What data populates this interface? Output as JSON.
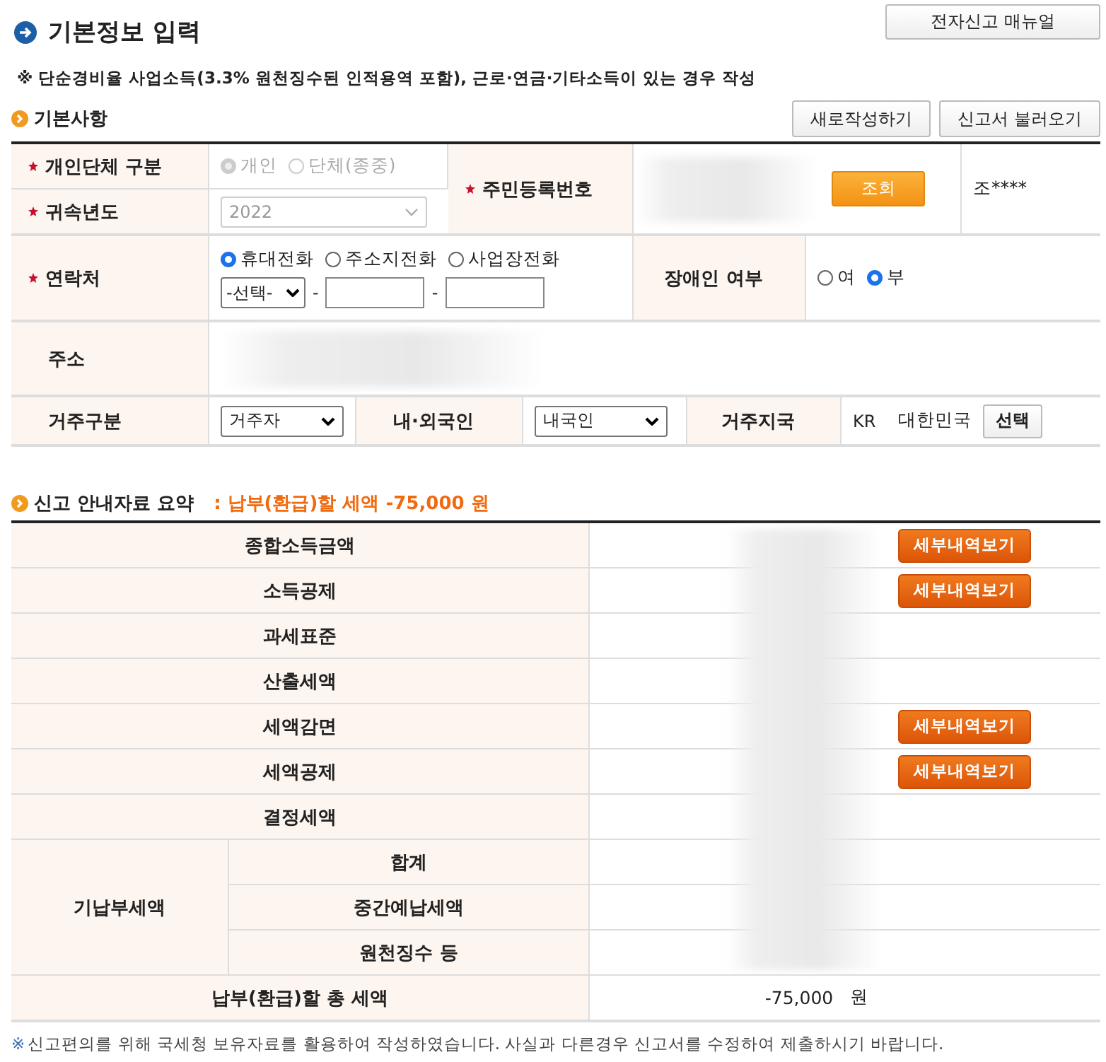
{
  "page_title": "기본정보 입력",
  "manual_button": "전자신고 매뉴얼",
  "notice": "※ 단순경비율 사업소득(3.3% 원천징수된 인적용역 포함), 근로·연금·기타소득이 있는 경우 작성",
  "basic": {
    "title": "기본사항",
    "buttons": [
      "새로작성하기",
      "신고서 불러오기"
    ],
    "entity_type": {
      "label": "개인단체 구분",
      "required": true,
      "disabled": true,
      "options": [
        {
          "label": "개인",
          "selected": true
        },
        {
          "label": "단체(종중)",
          "selected": false
        }
      ]
    },
    "year": {
      "label": "귀속년도",
      "required": true,
      "value": "2022",
      "disabled": true
    },
    "resident_id": {
      "label": "주민등록번호",
      "required": true,
      "button": "조회",
      "name": "조****"
    },
    "contact": {
      "label": "연락처",
      "required": true,
      "options": [
        {
          "label": "휴대전화",
          "selected": true
        },
        {
          "label": "주소지전화",
          "selected": false
        },
        {
          "label": "사업장전화",
          "selected": false
        }
      ],
      "prefix": "-선택-",
      "separators": [
        "-",
        "-"
      ]
    },
    "disabled_person": {
      "label": "장애인 여부",
      "options": [
        {
          "label": "여",
          "selected": false
        },
        {
          "label": "부",
          "selected": true
        }
      ]
    },
    "address": {
      "label": "주소"
    },
    "residency": {
      "label": "거주구분",
      "value": "거주자"
    },
    "nationality": {
      "label": "내·외국인",
      "value": "내국인"
    },
    "country": {
      "label": "거주지국",
      "code": "KR",
      "name": "대한민국",
      "button": "선택"
    }
  },
  "summary": {
    "title": "신고 안내자료 요약",
    "headline": ": 납부(환급)할 세액 -75,000 원",
    "rows": [
      {
        "label": "종합소득금액",
        "button": "세부내역보기"
      },
      {
        "label": "소득공제",
        "button": "세부내역보기"
      },
      {
        "label": "과세표준"
      },
      {
        "label": "산출세액"
      },
      {
        "label": "세액감면",
        "button": "세부내역보기"
      },
      {
        "label": "세액공제",
        "button": "세부내역보기"
      },
      {
        "label": "결정세액"
      },
      {
        "label": "기납부세액",
        "children": [
          {
            "label": "합계"
          },
          {
            "label": "중간예납세액"
          },
          {
            "label": "원천징수 등"
          }
        ]
      }
    ],
    "total": {
      "label": "납부(환급)할 총 세액",
      "value": "-75,000",
      "unit": "원"
    }
  },
  "footnote_mark": "※",
  "footnote": "신고편의를 위해 국세청 보유자료를 활용하여 작성하였습니다. 사실과 다른경우 신고서를 수정하여 제출하시기 바랍니다."
}
